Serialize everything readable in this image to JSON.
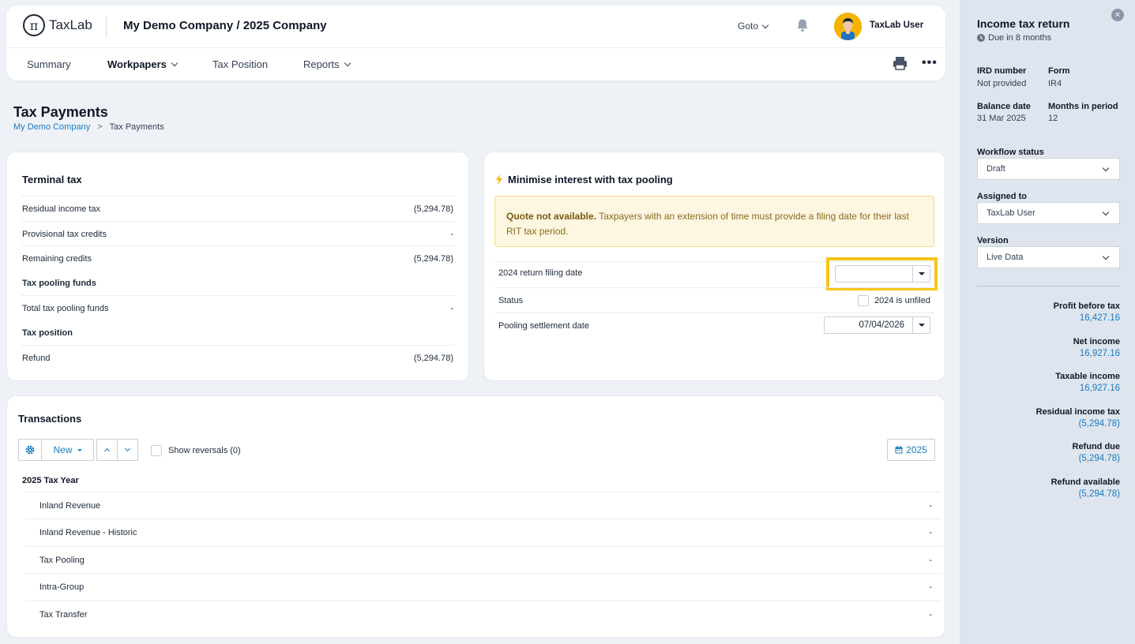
{
  "header": {
    "logo_symbol": "π",
    "logo_text": "TaxLab",
    "company": "My Demo Company / 2025 Company",
    "goto_label": "Goto",
    "user_name": "TaxLab User"
  },
  "nav": {
    "summary": "Summary",
    "workpapers": "Workpapers",
    "tax_position": "Tax Position",
    "reports": "Reports",
    "more": "•••"
  },
  "page": {
    "title": "Tax Payments",
    "breadcrumb_root": "My Demo Company",
    "breadcrumb_sep": ">",
    "breadcrumb_current": "Tax Payments"
  },
  "terminal_tax": {
    "title": "Terminal tax",
    "residual_label": "Residual income tax",
    "residual_value": "(5,294.78)",
    "provisional_label": "Provisional tax credits",
    "provisional_value": "-",
    "remaining_label": "Remaining credits",
    "remaining_value": "(5,294.78)",
    "pooling_section": "Tax pooling funds",
    "total_pooling_label": "Total tax pooling funds",
    "total_pooling_value": "-",
    "position_section": "Tax position",
    "refund_label": "Refund",
    "refund_value": "(5,294.78)"
  },
  "pooling": {
    "title": "Minimise interest with tax pooling",
    "notice_bold": "Quote not available.",
    "notice_text": " Taxpayers with an extension of time must provide a filing date for their last RIT tax period.",
    "filing_label": "2024 return filing date",
    "filing_value": "",
    "status_label": "Status",
    "unfiled_label": "2024 is unfiled",
    "settlement_label": "Pooling settlement date",
    "settlement_value": "07/04/2026",
    "highlight_color": "#f5c518"
  },
  "transactions": {
    "title": "Transactions",
    "new_label": "New",
    "show_reversals": "Show reversals (0)",
    "year_button": "2025",
    "year_group": "2025 Tax Year",
    "rows": [
      {
        "label": "Inland Revenue",
        "value": "-"
      },
      {
        "label": "Inland Revenue - Historic",
        "value": "-"
      },
      {
        "label": "Tax Pooling",
        "value": "-"
      },
      {
        "label": "Intra-Group",
        "value": "-"
      },
      {
        "label": "Tax Transfer",
        "value": "-"
      }
    ]
  },
  "panel": {
    "title": "Income tax return",
    "due": "Due in 8 months",
    "ird_label": "IRD number",
    "ird_value": "Not provided",
    "form_label": "Form",
    "form_value": "IR4",
    "balance_label": "Balance date",
    "balance_value": "31 Mar 2025",
    "months_label": "Months in period",
    "months_value": "12",
    "workflow_label": "Workflow status",
    "workflow_value": "Draft",
    "assigned_label": "Assigned to",
    "assigned_value": "TaxLab User",
    "version_label": "Version",
    "version_value": "Live Data",
    "metrics": [
      {
        "label": "Profit before tax",
        "value": "16,427.16"
      },
      {
        "label": "Net income",
        "value": "16,927.16"
      },
      {
        "label": "Taxable income",
        "value": "16,927.16"
      },
      {
        "label": "Residual income tax",
        "value": "(5,294.78)"
      },
      {
        "label": "Refund due",
        "value": "(5,294.78)"
      },
      {
        "label": "Refund available",
        "value": "(5,294.78)"
      }
    ]
  },
  "colors": {
    "accent_blue": "#1a7bbf",
    "highlight_yellow": "#f5c518",
    "panel_bg": "#dfe5ee"
  },
  "icons": {
    "logo": "pi-logo-icon",
    "bell": "bell-icon",
    "avatar": "user-avatar-icon",
    "printer": "printer-icon",
    "lightning": "lightning-icon",
    "gear": "gear-icon",
    "calendar": "calendar-icon",
    "clock": "clock-icon",
    "close": "close-icon"
  }
}
